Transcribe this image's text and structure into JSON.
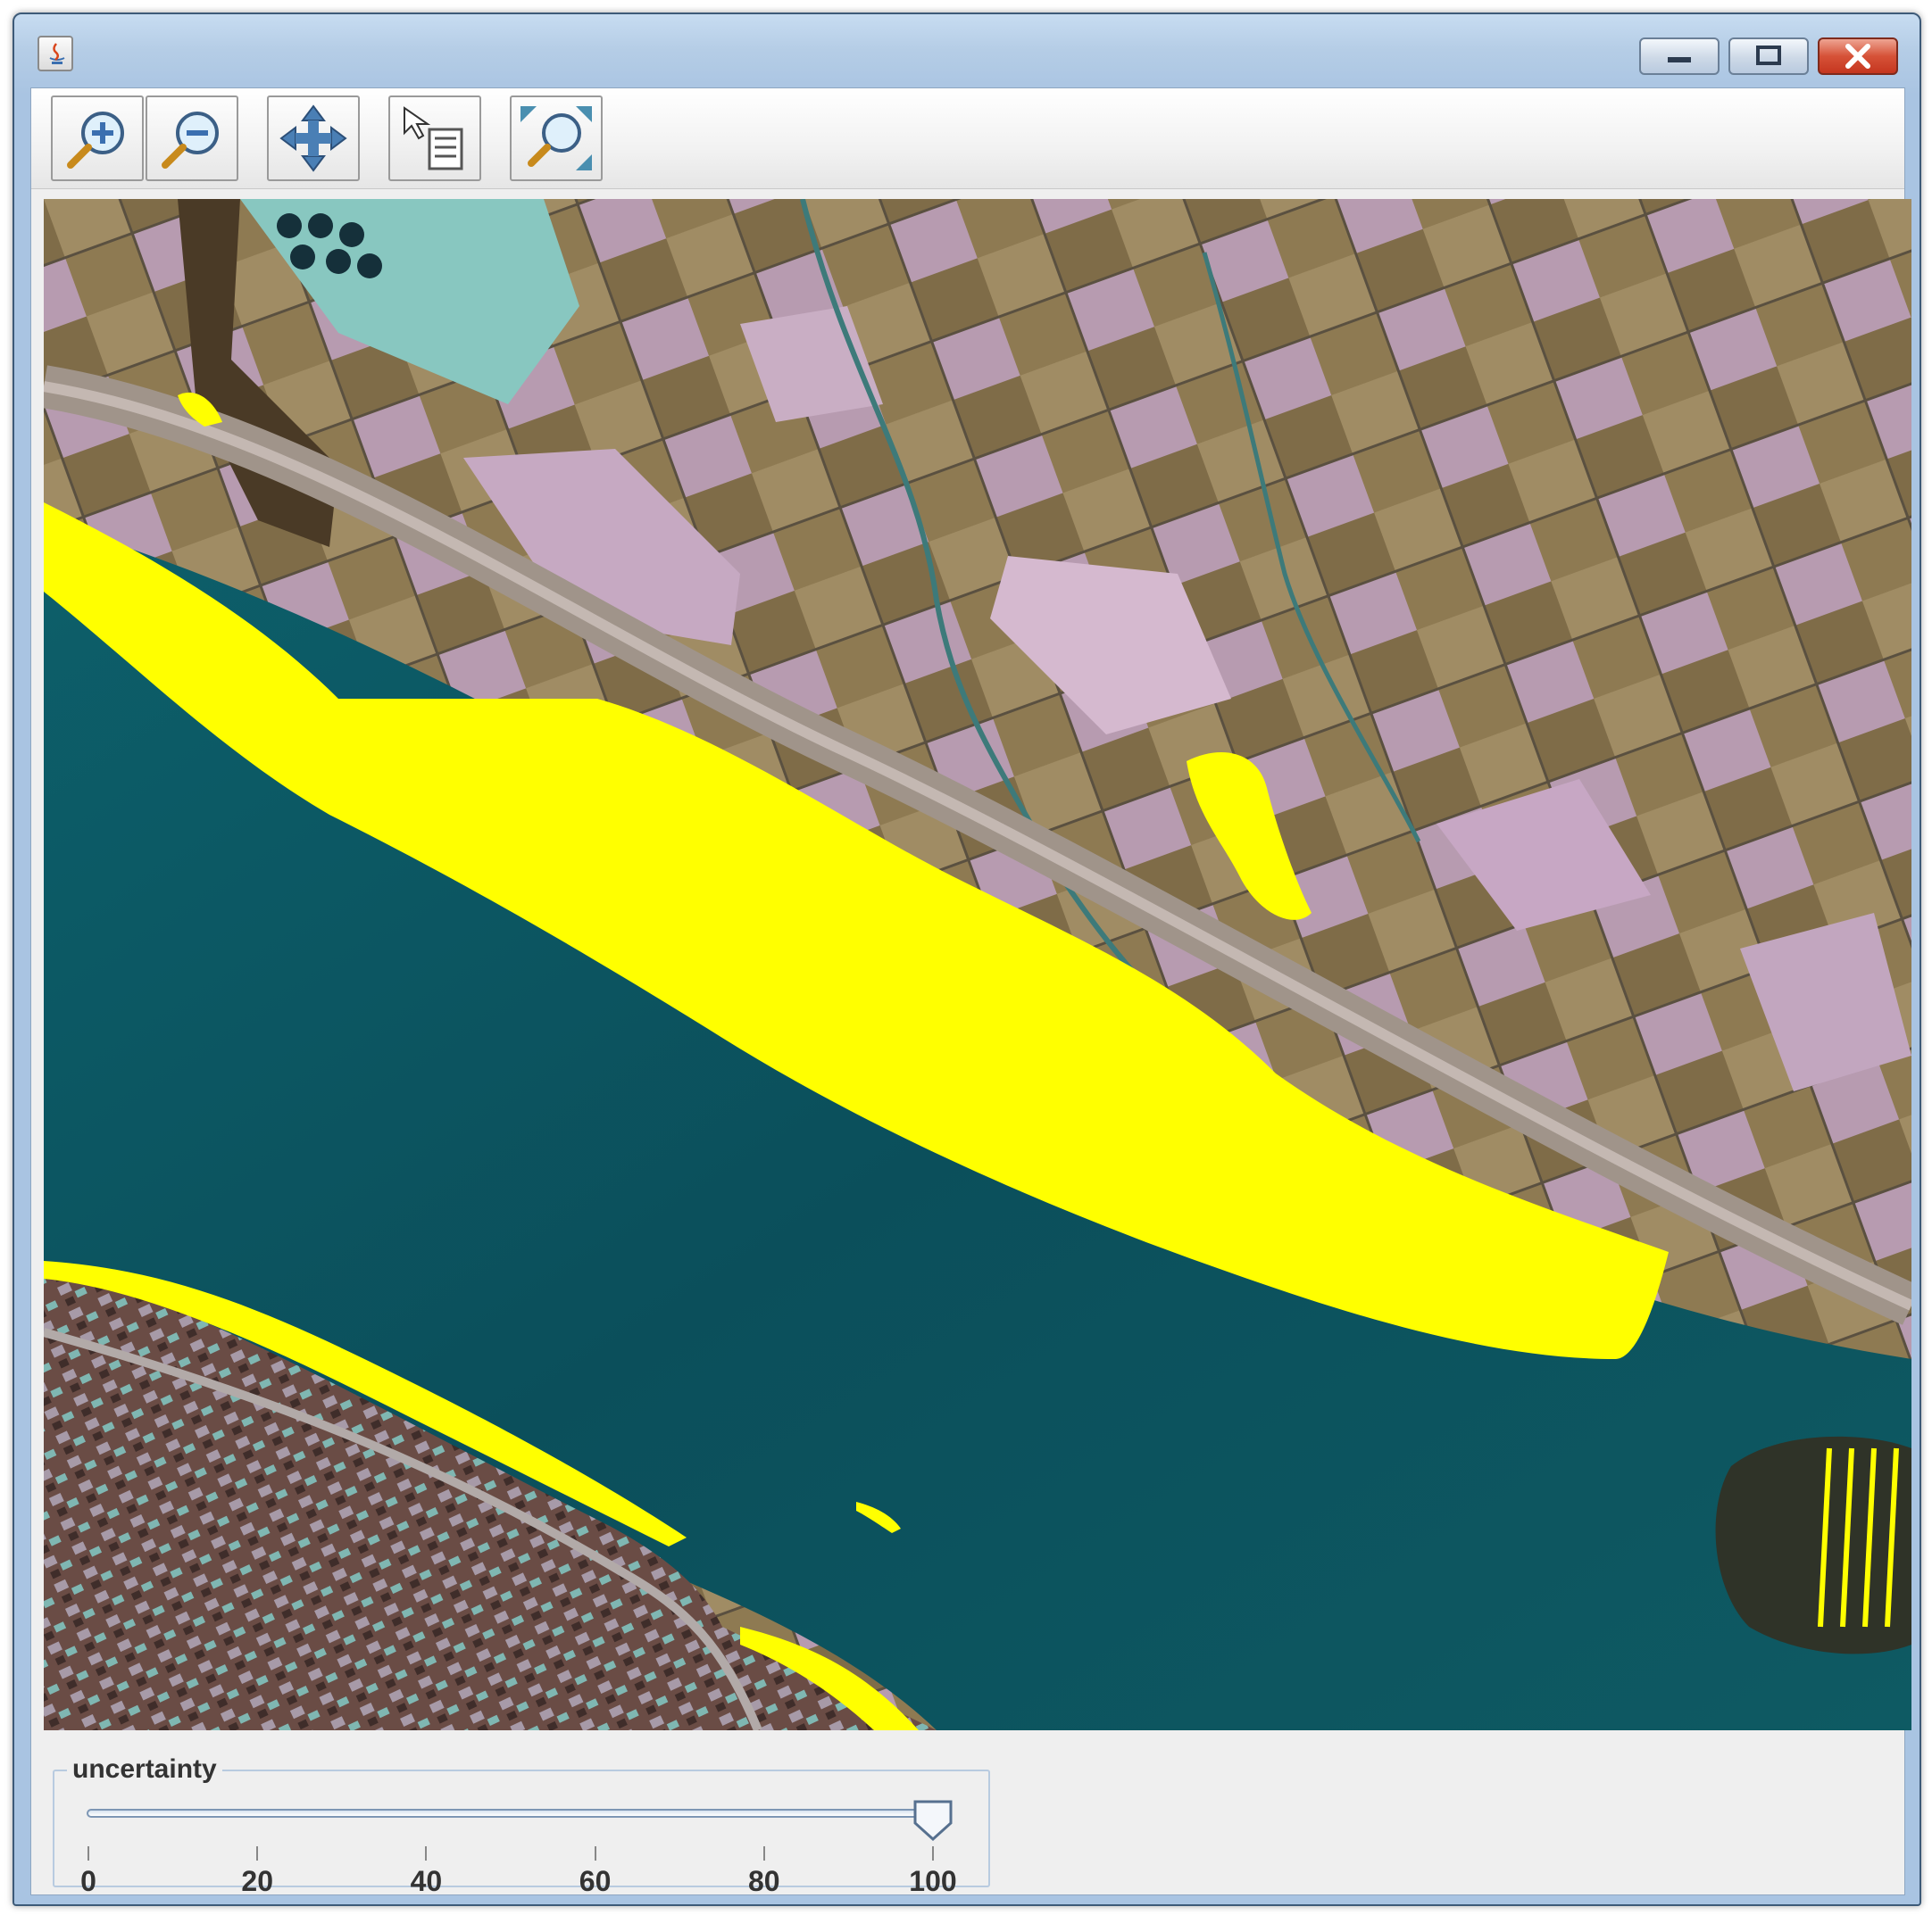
{
  "window": {
    "title": "",
    "controls": [
      "minimize",
      "maximize",
      "close"
    ]
  },
  "toolbar": {
    "buttons": [
      {
        "name": "zoom-in",
        "icon": "zoom-in-icon"
      },
      {
        "name": "zoom-out",
        "icon": "zoom-out-icon"
      },
      {
        "name": "pan",
        "icon": "pan-arrows-icon"
      },
      {
        "name": "info-select",
        "icon": "pointer-info-icon"
      },
      {
        "name": "zoom-to-extent",
        "icon": "zoom-extent-icon"
      }
    ]
  },
  "map": {
    "description_type": "satellite image with yellow classification overlay",
    "overlay_color": "#ffff00"
  },
  "slider": {
    "title": "uncertainty",
    "min": 0,
    "max": 100,
    "value": 100,
    "tick_labels": [
      "0",
      "20",
      "40",
      "60",
      "80",
      "100"
    ]
  },
  "colors": {
    "water": "#0f5a62",
    "overlay": "#ffff00",
    "window_frame": "#b5cde6"
  }
}
